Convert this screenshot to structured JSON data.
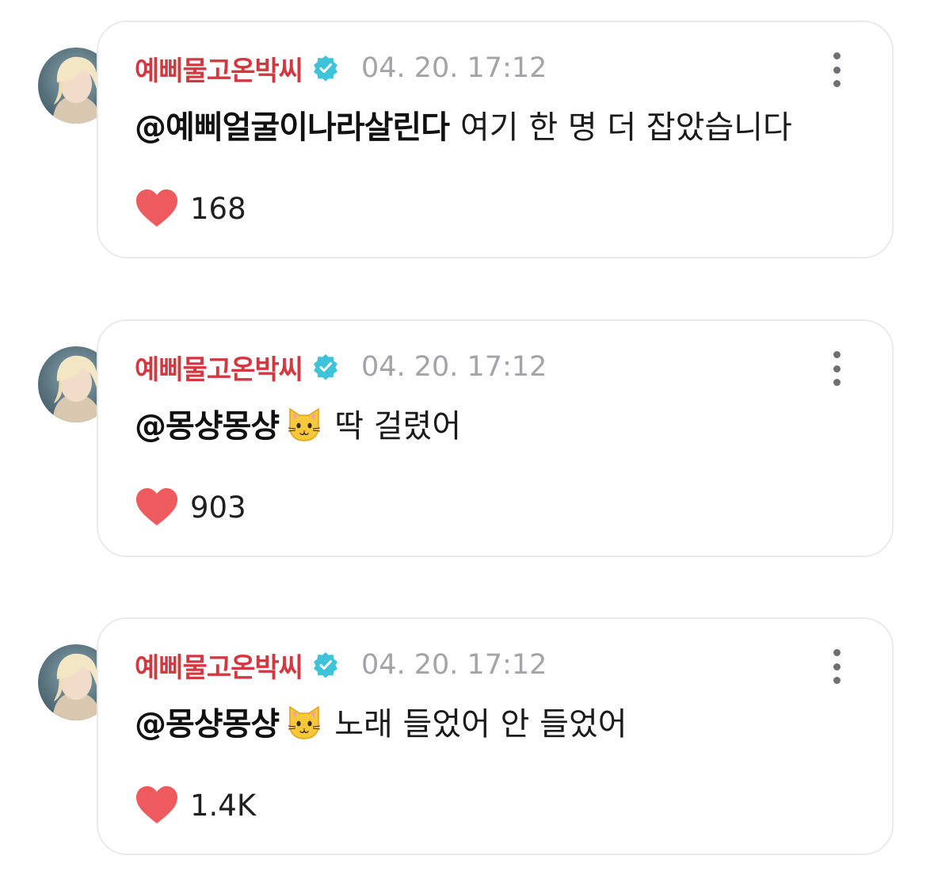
{
  "comments": [
    {
      "username": "예삐물고온박씨",
      "timestamp": "04. 20. 17:12",
      "mention": "@예삐얼굴이나라살린다",
      "has_emoji": false,
      "text": "여기 한 명 더 잡았습니다",
      "likes": "168"
    },
    {
      "username": "예삐물고온박씨",
      "timestamp": "04. 20. 17:12",
      "mention": "@몽샹몽샹",
      "has_emoji": true,
      "emoji": "cat-face-emoji",
      "text": "딱 걸렸어",
      "likes": "903"
    },
    {
      "username": "예삐물고온박씨",
      "timestamp": "04. 20. 17:12",
      "mention": "@몽샹몽샹",
      "has_emoji": true,
      "emoji": "cat-face-emoji",
      "text": "노래 들었어 안 들었어",
      "likes": "1.4K"
    }
  ],
  "colors": {
    "username": "#d2383f",
    "timestamp": "#a3a3a8",
    "heart": "#ee5b5f",
    "verified": "#3ec3d9",
    "card_border": "#e9e9ee"
  },
  "icons": {
    "verified": "verified-badge-icon",
    "more": "more-vertical-icon",
    "like": "heart-icon"
  }
}
